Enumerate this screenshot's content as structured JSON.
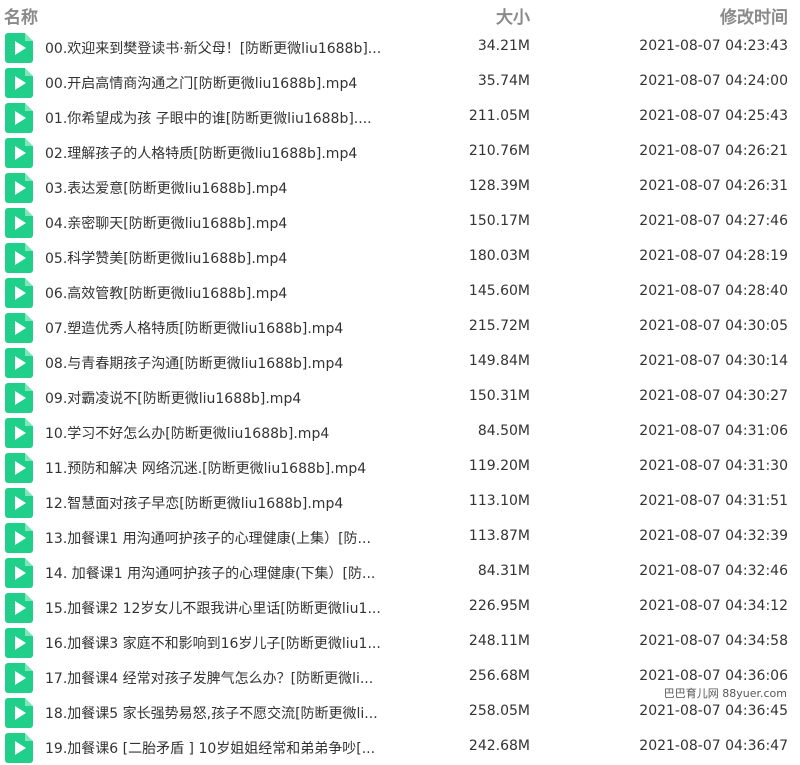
{
  "header": {
    "name": "名称",
    "size": "大小",
    "modified": "修改时间"
  },
  "files": [
    {
      "name": "00.欢迎来到樊登读书·新父母！[防断更微liu1688b]...",
      "size": "34.21M",
      "modified": "2021-08-07 04:23:43",
      "icon": "video-file-icon"
    },
    {
      "name": "00.开启高情商沟通之门[防断更微liu1688b].mp4",
      "size": "35.74M",
      "modified": "2021-08-07 04:24:00",
      "icon": "video-file-icon"
    },
    {
      "name": "01.你希望成为孩 子眼中的谁[防断更微liu1688b]....",
      "size": "211.05M",
      "modified": "2021-08-07 04:25:43",
      "icon": "video-file-icon"
    },
    {
      "name": "02.理解孩子的人格特质[防断更微liu1688b].mp4",
      "size": "210.76M",
      "modified": "2021-08-07 04:26:21",
      "icon": "video-file-icon"
    },
    {
      "name": "03.表达爱意[防断更微liu1688b].mp4",
      "size": "128.39M",
      "modified": "2021-08-07 04:26:31",
      "icon": "video-file-icon"
    },
    {
      "name": "04.亲密聊天[防断更微liu1688b].mp4",
      "size": "150.17M",
      "modified": "2021-08-07 04:27:46",
      "icon": "video-file-icon"
    },
    {
      "name": "05.科学赞美[防断更微liu1688b].mp4",
      "size": "180.03M",
      "modified": "2021-08-07 04:28:19",
      "icon": "video-file-icon"
    },
    {
      "name": "06.高效管教[防断更微liu1688b].mp4",
      "size": "145.60M",
      "modified": "2021-08-07 04:28:40",
      "icon": "video-file-icon"
    },
    {
      "name": "07.塑造优秀人格特质[防断更微liu1688b].mp4",
      "size": "215.72M",
      "modified": "2021-08-07 04:30:05",
      "icon": "video-file-icon"
    },
    {
      "name": "08.与青春期孩子沟通[防断更微liu1688b].mp4",
      "size": "149.84M",
      "modified": "2021-08-07 04:30:14",
      "icon": "video-file-icon"
    },
    {
      "name": "09.对霸凌说不[防断更微liu1688b].mp4",
      "size": "150.31M",
      "modified": "2021-08-07 04:30:27",
      "icon": "video-file-icon"
    },
    {
      "name": "10.学习不好怎么办[防断更微liu1688b].mp4",
      "size": "84.50M",
      "modified": "2021-08-07 04:31:06",
      "icon": "video-file-icon"
    },
    {
      "name": "11.预防和解决 网络沉迷.[防断更微liu1688b].mp4",
      "size": "119.20M",
      "modified": "2021-08-07 04:31:30",
      "icon": "video-file-icon"
    },
    {
      "name": "12.智慧面对孩子早恋[防断更微liu1688b].mp4",
      "size": "113.10M",
      "modified": "2021-08-07 04:31:51",
      "icon": "video-file-icon"
    },
    {
      "name": "13.加餐课1 用沟通呵护孩子的心理健康(上集）[防...",
      "size": "113.87M",
      "modified": "2021-08-07 04:32:39",
      "icon": "video-file-icon"
    },
    {
      "name": "14. 加餐课1 用沟通呵护孩子的心理健康(下集）[防...",
      "size": "84.31M",
      "modified": "2021-08-07 04:32:46",
      "icon": "video-file-icon"
    },
    {
      "name": "15.加餐课2 12岁女儿不跟我讲心里话[防断更微liu1...",
      "size": "226.95M",
      "modified": "2021-08-07 04:34:12",
      "icon": "video-file-icon"
    },
    {
      "name": "16.加餐课3 家庭不和影响到16岁儿子[防断更微liu1...",
      "size": "248.11M",
      "modified": "2021-08-07 04:34:58",
      "icon": "video-file-icon"
    },
    {
      "name": "17.加餐课4 经常对孩子发脾气怎么办？[防断更微li...",
      "size": "256.68M",
      "modified": "2021-08-07 04:36:06",
      "icon": "video-file-icon"
    },
    {
      "name": "18.加餐课5 家长强势易怒,孩子不愿交流[防断更微li...",
      "size": "258.05M",
      "modified": "2021-08-07 04:36:45",
      "icon": "video-file-icon"
    },
    {
      "name": "19.加餐课6 [二胎矛盾 ] 10岁姐姐经常和弟弟争吵[...",
      "size": "242.68M",
      "modified": "2021-08-07 04:36:47",
      "icon": "video-file-icon"
    }
  ],
  "watermark": "巴巴育儿网 88yuer.com",
  "colors": {
    "icon": "#1fcf8a",
    "header_text": "#8a8a8a",
    "row_text": "#333333"
  }
}
